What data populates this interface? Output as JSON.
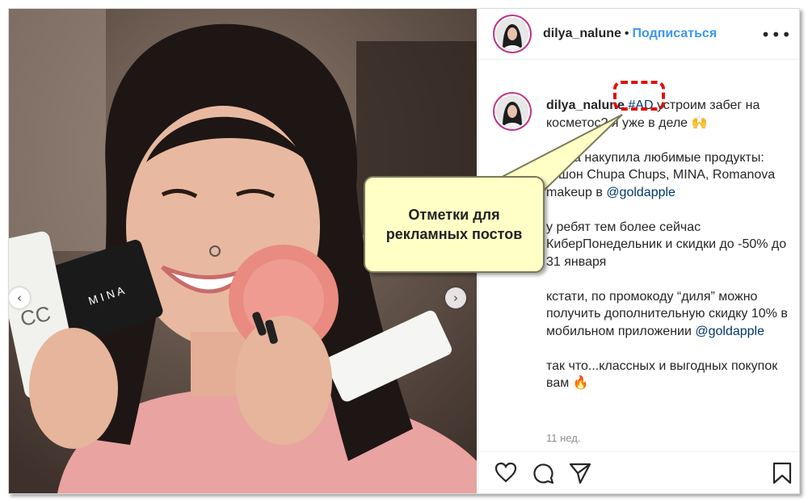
{
  "header": {
    "username": "dilya_nalune",
    "separator": "•",
    "follow_label": "Подписаться",
    "more_icon": "more-dots-icon"
  },
  "caption": {
    "username": "dilya_nalune",
    "hashtag": "#AD",
    "line1_rest": " устроим забег на косметос? я уже в деле 🙌",
    "para2_a": "снова накупила любимые продукты: кушон Chupa Chups, MINA, Romanova makeup в ",
    "mention1": "@goldapple",
    "para3": "у ребят тем более сейчас КиберПонедельник и скидки до -50% до 31 января",
    "para4_a": "кстати, по промокоду “диля” можно получить дополнительную скидку 10% в мобильном приложении ",
    "mention2": "@goldapple",
    "para5": "так что...классных и выгодных покупок вам 🔥"
  },
  "timestamp": "11 нед.",
  "callout": {
    "text_line1": "Отметки для",
    "text_line2": "рекламных постов"
  },
  "carousel": {
    "prev_icon": "‹",
    "next_icon": "›"
  },
  "colors": {
    "link_blue": "#3897f0",
    "hashtag": "#00376b",
    "highlight_red": "#e01010",
    "callout_bg": "#ffffc6"
  }
}
